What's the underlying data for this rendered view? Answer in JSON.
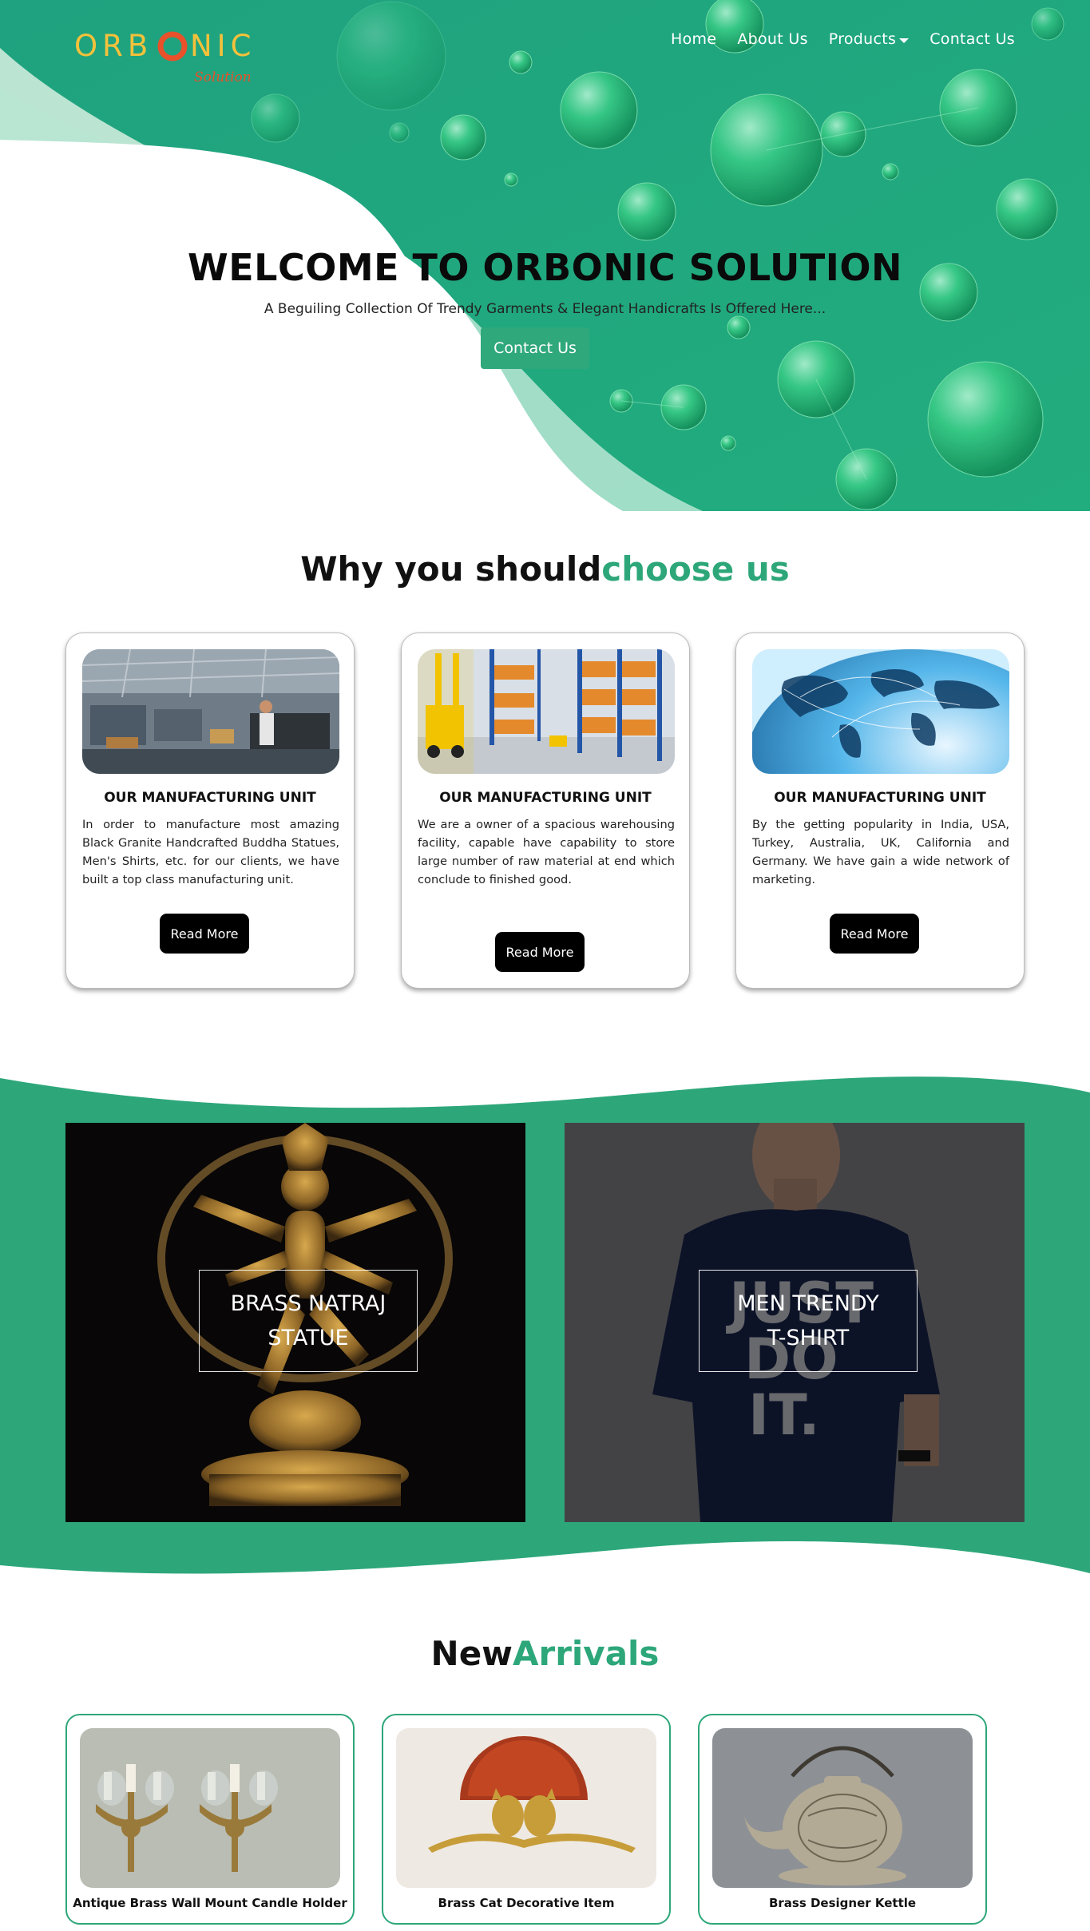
{
  "header": {
    "logo_text": "ORBONIC",
    "logo_tagline": "Solution",
    "nav": {
      "home": "Home",
      "about": "About Us",
      "products": "Products",
      "contact": "Contact Us"
    }
  },
  "hero": {
    "title": "WELCOME TO ORBONIC SOLUTION",
    "subtitle": "A Beguiling Collection Of Trendy Garments & Elegant Handicrafts Is Offered Here...",
    "button": "Contact Us"
  },
  "why": {
    "title_dark": "Why you should",
    "title_green": "choose us",
    "cards": [
      {
        "image": "factory-photo",
        "title": "OUR MANUFACTURING UNIT",
        "text": "In order to manufacture most amazing Black Granite Handcrafted Buddha Statues, Men's Shirts, etc. for our clients, we have built a top class manufacturing unit.",
        "button": "Read More"
      },
      {
        "image": "warehouse-photo",
        "title": "OUR MANUFACTURING UNIT",
        "text": "We are a owner of a spacious warehousing facility, capable have capability to store large number of raw material at end which conclude to finished good.",
        "button": "Read More"
      },
      {
        "image": "globe-network-photo",
        "title": "OUR MANUFACTURING UNIT",
        "text": "By the getting popularity in India, USA, Turkey, Australia, UK, California and Germany. We have gain a wide network of marketing.",
        "button": "Read More"
      }
    ]
  },
  "featured": {
    "natraj": {
      "line1": "BRASS NATRAJ",
      "line2": "STATUE"
    },
    "tshirt": {
      "line1": "MEN TRENDY",
      "line2": "T-SHIRT",
      "shirt_print": "JUST DO IT."
    }
  },
  "new_arrivals": {
    "title_dark": "New",
    "title_green": "Arrivals",
    "items": [
      {
        "name": "Antique Brass Wall Mount Candle Holder"
      },
      {
        "name": "Brass Cat Decorative Item"
      },
      {
        "name": "Brass Designer Kettle"
      }
    ]
  },
  "colors": {
    "brand_green": "#2da77a",
    "hero_green": "#21a77c",
    "button_black": "#000000",
    "logo_orange": "#e8512a",
    "logo_yellow": "#f5c13a"
  }
}
